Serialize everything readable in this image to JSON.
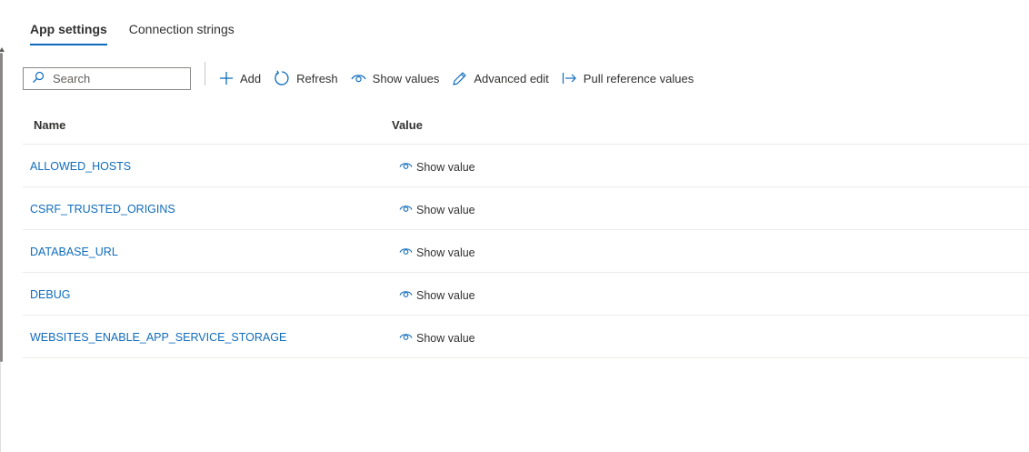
{
  "tabs": [
    {
      "label": "App settings",
      "active": true
    },
    {
      "label": "Connection strings",
      "active": false
    }
  ],
  "search": {
    "placeholder": "Search",
    "value": ""
  },
  "toolbar": {
    "add_label": "Add",
    "refresh_label": "Refresh",
    "show_values_label": "Show values",
    "advanced_edit_label": "Advanced edit",
    "pull_reference_label": "Pull reference values"
  },
  "table": {
    "columns": [
      "Name",
      "Value"
    ],
    "rows": [
      {
        "name": "ALLOWED_HOSTS",
        "value": "Show value"
      },
      {
        "name": "CSRF_TRUSTED_ORIGINS",
        "value": "Show value"
      },
      {
        "name": "DATABASE_URL",
        "value": "Show value"
      },
      {
        "name": "DEBUG",
        "value": "Show value"
      },
      {
        "name": "WEBSITES_ENABLE_APP_SERVICE_STORAGE",
        "value": "Show value"
      }
    ]
  },
  "colors": {
    "accent": "#0f6cbd",
    "text": "#323130",
    "divider": "#edebe9"
  },
  "icons": [
    "search-icon",
    "plus-icon",
    "refresh-icon",
    "eye-icon",
    "pencil-icon",
    "pull-arrow-icon"
  ]
}
